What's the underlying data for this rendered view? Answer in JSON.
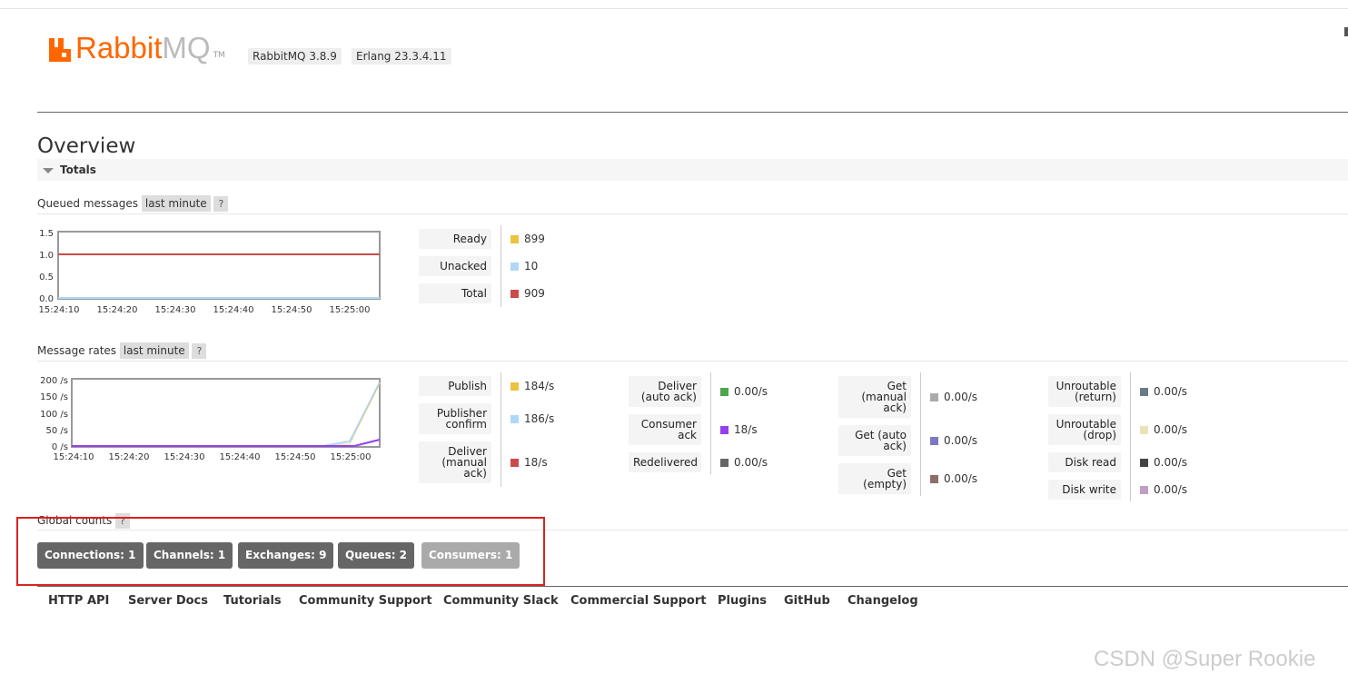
{
  "header": {
    "logo_brand": "Rabbit",
    "logo_mq": "MQ",
    "logo_tm": "TM",
    "rabbitmq_version": "RabbitMQ 3.8.9",
    "erlang_version": "Erlang 23.3.4.11"
  },
  "page_title": "Overview",
  "totals_label": "Totals",
  "queued": {
    "heading": "Queued messages",
    "range": "last minute",
    "help": "?",
    "y_ticks": [
      "1.5",
      "1.0",
      "0.5",
      "0.0"
    ],
    "x_ticks": [
      "15:24:10",
      "15:24:20",
      "15:24:30",
      "15:24:40",
      "15:24:50",
      "15:25:00"
    ],
    "legend": [
      {
        "label": "Ready",
        "value": "899",
        "color": "#edc240"
      },
      {
        "label": "Unacked",
        "value": "10",
        "color": "#afd8f8"
      },
      {
        "label": "Total",
        "value": "909",
        "color": "#cb4b4b"
      }
    ]
  },
  "rates": {
    "heading": "Message rates",
    "range": "last minute",
    "help": "?",
    "y_ticks": [
      "200 /s",
      "150 /s",
      "100 /s",
      "50 /s",
      "0 /s"
    ],
    "x_ticks": [
      "15:24:10",
      "15:24:20",
      "15:24:30",
      "15:24:40",
      "15:24:50",
      "15:25:00"
    ],
    "col1": [
      {
        "label": "Publish",
        "value": "184/s",
        "color": "#edc240"
      },
      {
        "label": "Publisher confirm",
        "value": "186/s",
        "color": "#afd8f8"
      },
      {
        "label": "Deliver (manual ack)",
        "value": "18/s",
        "color": "#cb4b4b"
      }
    ],
    "col2": [
      {
        "label": "Deliver (auto ack)",
        "value": "0.00/s",
        "color": "#4da74d"
      },
      {
        "label": "Consumer ack",
        "value": "18/s",
        "color": "#9440ed"
      },
      {
        "label": "Redelivered",
        "value": "0.00/s",
        "color": "#666666"
      }
    ],
    "col3": [
      {
        "label": "Get (manual ack)",
        "value": "0.00/s",
        "color": "#aaaaaa"
      },
      {
        "label": "Get (auto ack)",
        "value": "0.00/s",
        "color": "#7c79c3"
      },
      {
        "label": "Get (empty)",
        "value": "0.00/s",
        "color": "#8d6d6c"
      }
    ],
    "col4": [
      {
        "label": "Unroutable (return)",
        "value": "0.00/s",
        "color": "#697b87"
      },
      {
        "label": "Unroutable (drop)",
        "value": "0.00/s",
        "color": "#e8e4b8"
      },
      {
        "label": "Disk read",
        "value": "0.00/s",
        "color": "#444444"
      },
      {
        "label": "Disk write",
        "value": "0.00/s",
        "color": "#bf9fc6"
      }
    ]
  },
  "global_counts": {
    "heading": "Global counts",
    "help": "?",
    "connections": "Connections: 1",
    "channels": "Channels: 1",
    "exchanges": "Exchanges: 9",
    "queues": "Queues: 2",
    "consumers": "Consumers: 1"
  },
  "footer_links": [
    "HTTP API",
    "Server Docs",
    "Tutorials",
    "Community Support",
    "Community Slack",
    "Commercial Support",
    "Plugins",
    "GitHub",
    "Changelog"
  ],
  "watermark": "CSDN @Super Rookie"
}
